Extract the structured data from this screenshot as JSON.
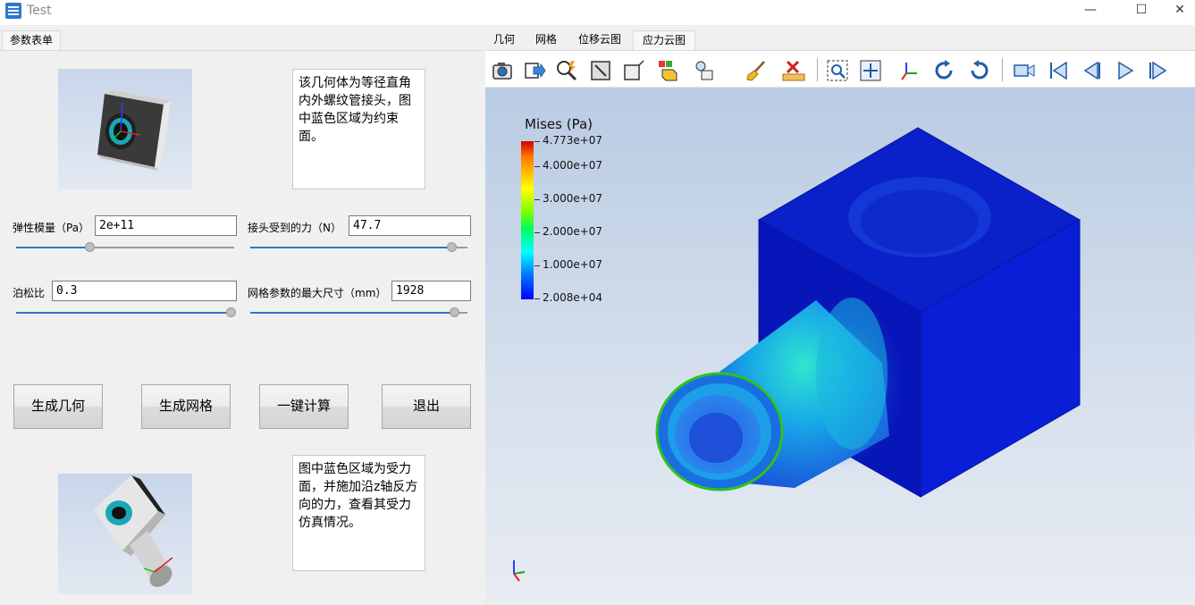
{
  "window": {
    "title": "Test",
    "minimize_glyph": "—",
    "maximize_glyph": "☐",
    "close_glyph": "✕"
  },
  "left": {
    "tab_label": "参数表单",
    "top_description": "该几何体为等径直角内外螺纹管接头，图中蓝色区域为约束面。",
    "bottom_description": "图中蓝色区域为受力面，并施加沿z轴反方向的力，查看其受力仿真情况。",
    "params": {
      "elastic_modulus": {
        "label": "弹性模量（Pa）",
        "value": "2e+11",
        "slider_level": 0.33
      },
      "force": {
        "label": "接头受到的力（N）",
        "value": "47.7",
        "slider_level": 0.95
      },
      "poisson": {
        "label": "泊松比",
        "value": "0.3",
        "slider_level": 1.0
      },
      "mesh_size": {
        "label": "网格参数的最大尺寸（mm）",
        "value": "1928",
        "slider_level": 0.96
      }
    },
    "buttons": {
      "generate_geometry": "生成几何",
      "generate_mesh": "生成网格",
      "compute": "一键计算",
      "exit": "退出"
    }
  },
  "right": {
    "tabs": [
      "几何",
      "网格",
      "位移云图",
      "应力云图"
    ],
    "active_tab": "应力云图",
    "toolbar_icons": [
      "camera-icon",
      "export-icon",
      "zoom-pick-icon",
      "fit-view-icon",
      "box-view-icon",
      "color-cube-icon",
      "light-icon",
      "brush-icon",
      "ruler-icon",
      "zoom-box-icon",
      "move-icon",
      "axes-icon",
      "rotate-cw-icon",
      "rotate-ccw-icon",
      "record-icon",
      "first-frame-icon",
      "prev-frame-icon",
      "play-icon",
      "last-frame-icon"
    ],
    "legend": {
      "title": "Mises (Pa)",
      "ticks": [
        "4.773e+07",
        "4.000e+07",
        "3.000e+07",
        "2.000e+07",
        "1.000e+07",
        "2.008e+04"
      ],
      "tick_values": [
        47730000,
        40000000,
        30000000,
        20000000,
        10000000,
        20080
      ],
      "colors": [
        "#d40000",
        "#ffff00",
        "#00ff5a",
        "#00ffff",
        "#0000ff"
      ]
    }
  }
}
